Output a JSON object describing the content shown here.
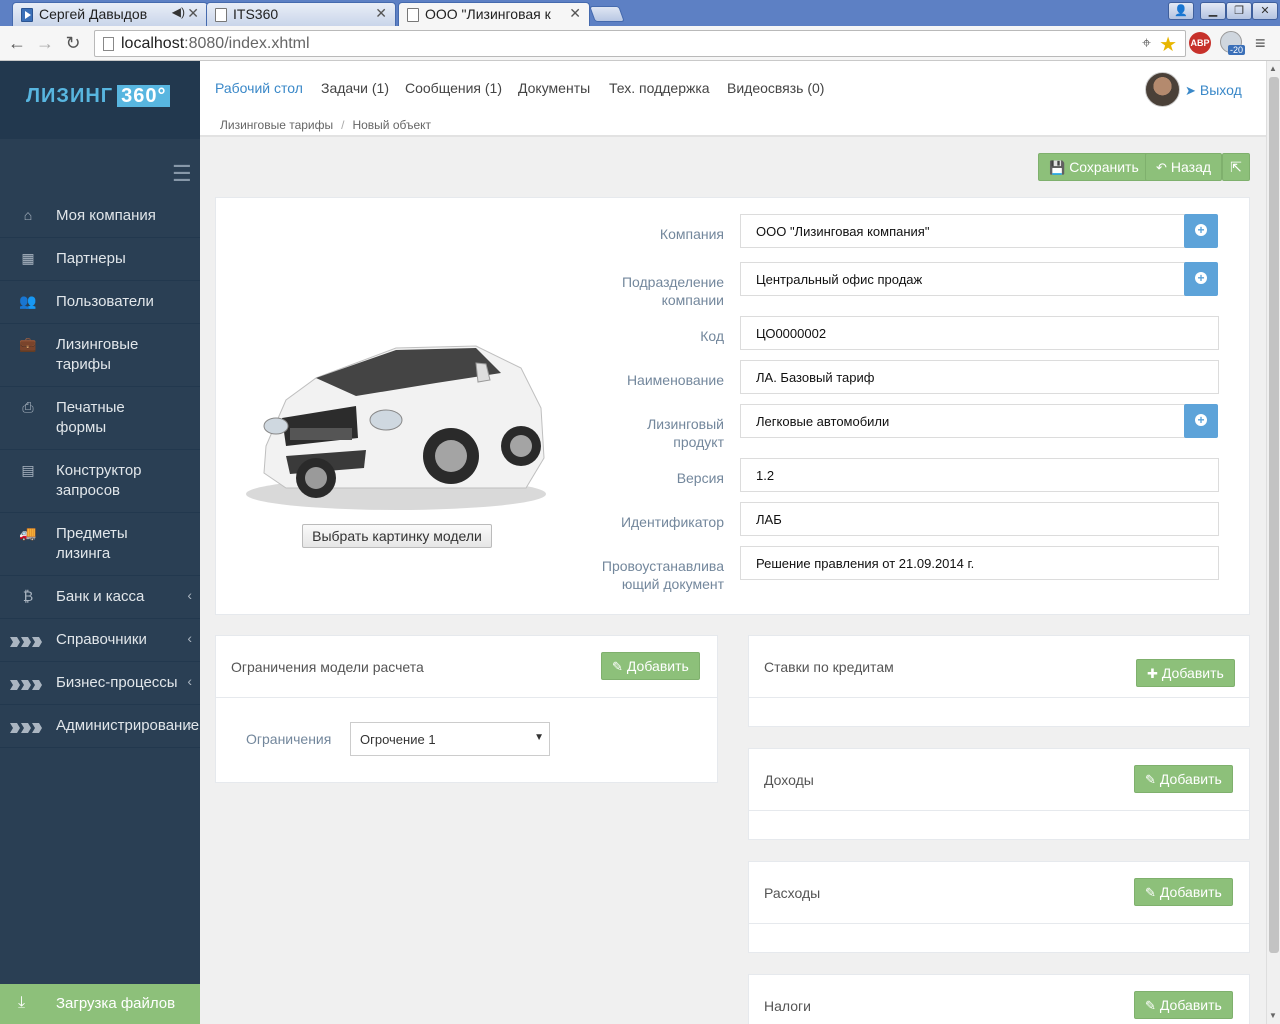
{
  "browser": {
    "tabs": [
      {
        "title": "Сергей Давыдов"
      },
      {
        "title": "ITS360"
      },
      {
        "title": "ООО \"Лизинговая к"
      }
    ],
    "url_host": "localhost",
    "url_rest": ":8080/index.xhtml",
    "ext_badge": "-20",
    "abp_label": "ABP"
  },
  "logo": {
    "text": "ЛИЗИНГ",
    "box": "360°"
  },
  "sidebar": {
    "items": [
      {
        "label": "Моя компания"
      },
      {
        "label": "Партнеры"
      },
      {
        "label": "Пользователи"
      },
      {
        "label": "Лизинговые тарифы"
      },
      {
        "label": "Печатные формы"
      },
      {
        "label": "Конструктор запросов"
      },
      {
        "label": "Предметы лизинга"
      },
      {
        "label": "Банк и касса"
      },
      {
        "label": "Справочники"
      },
      {
        "label": "Бизнес-процессы"
      },
      {
        "label": "Администрирование"
      }
    ],
    "upload": "Загрузка файлов"
  },
  "topnav": {
    "items": [
      "Рабочий стол",
      "Задачи (1)",
      "Сообщения (1)",
      "Документы",
      "Тех. поддержка",
      "Видеосвязь (0)"
    ],
    "logout": "Выход"
  },
  "breadcrumb": [
    "Лизинговые тарифы",
    "Новый объект"
  ],
  "toolbar": {
    "save": "Сохранить",
    "back": "Назад"
  },
  "form": {
    "pick_image": "Выбрать картинку модели",
    "fields": [
      {
        "label": "Компания",
        "value": "ООО \"Лизинговая компания\""
      },
      {
        "label": "Подразделение компании",
        "value": "Центральный офис продаж"
      },
      {
        "label": "Код",
        "value": "ЦО0000002"
      },
      {
        "label": "Наименование",
        "value": "ЛА. Базовый тариф"
      },
      {
        "label": "Лизинговый продукт",
        "value": "Легковые автомобили"
      },
      {
        "label": "Версия",
        "value": "1.2"
      },
      {
        "label": "Идентификатор",
        "value": "ЛАБ"
      },
      {
        "label": "Провоустанавливающий документ",
        "value": "Решение правления от 21.09.2014 г."
      }
    ]
  },
  "limits": {
    "title": "Ограничения модели расчета",
    "add": "Добавить",
    "label": "Ограничения",
    "selected": "Огрочение 1"
  },
  "right_panels": [
    {
      "title": "Ставки по кредитам",
      "add": "Добавить"
    },
    {
      "title": "Доходы",
      "add": "Добавить"
    },
    {
      "title": "Расходы",
      "add": "Добавить"
    },
    {
      "title": "Налоги",
      "add": "Добавить"
    }
  ]
}
